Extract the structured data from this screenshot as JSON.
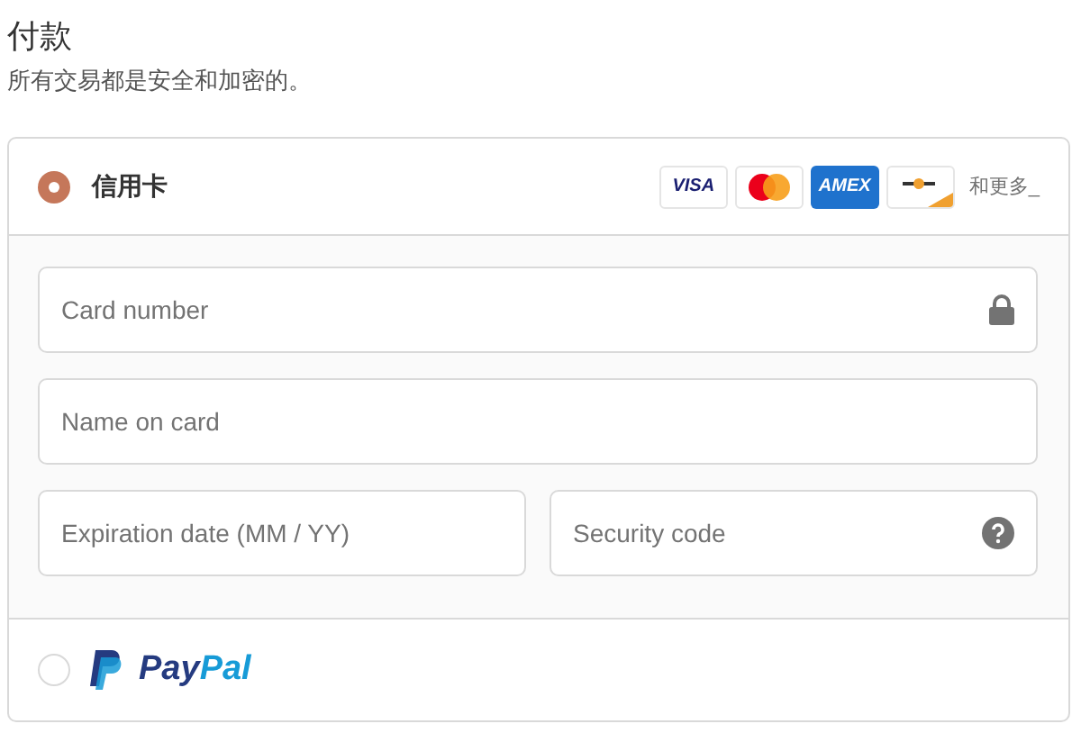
{
  "title": "付款",
  "subtitle": "所有交易都是安全和加密的。",
  "methods": [
    {
      "kind": "card",
      "label": "信用卡",
      "selected": true,
      "brands": [
        {
          "kind": "visa",
          "text": "VISA"
        },
        {
          "kind": "mastercard"
        },
        {
          "kind": "amex",
          "text": "AMEX"
        },
        {
          "kind": "generic"
        }
      ],
      "more": "和更多_",
      "fields": [
        {
          "placeholder": "Card number",
          "kind": "lock"
        },
        {
          "placeholder": "Name on card"
        }
      ],
      "row": [
        {
          "placeholder": "Expiration date (MM / YY)"
        },
        {
          "placeholder": "Security code",
          "kind": "help"
        }
      ]
    },
    {
      "kind": "paypal",
      "selected": false,
      "logo": [
        "Pay",
        "Pal"
      ]
    }
  ]
}
